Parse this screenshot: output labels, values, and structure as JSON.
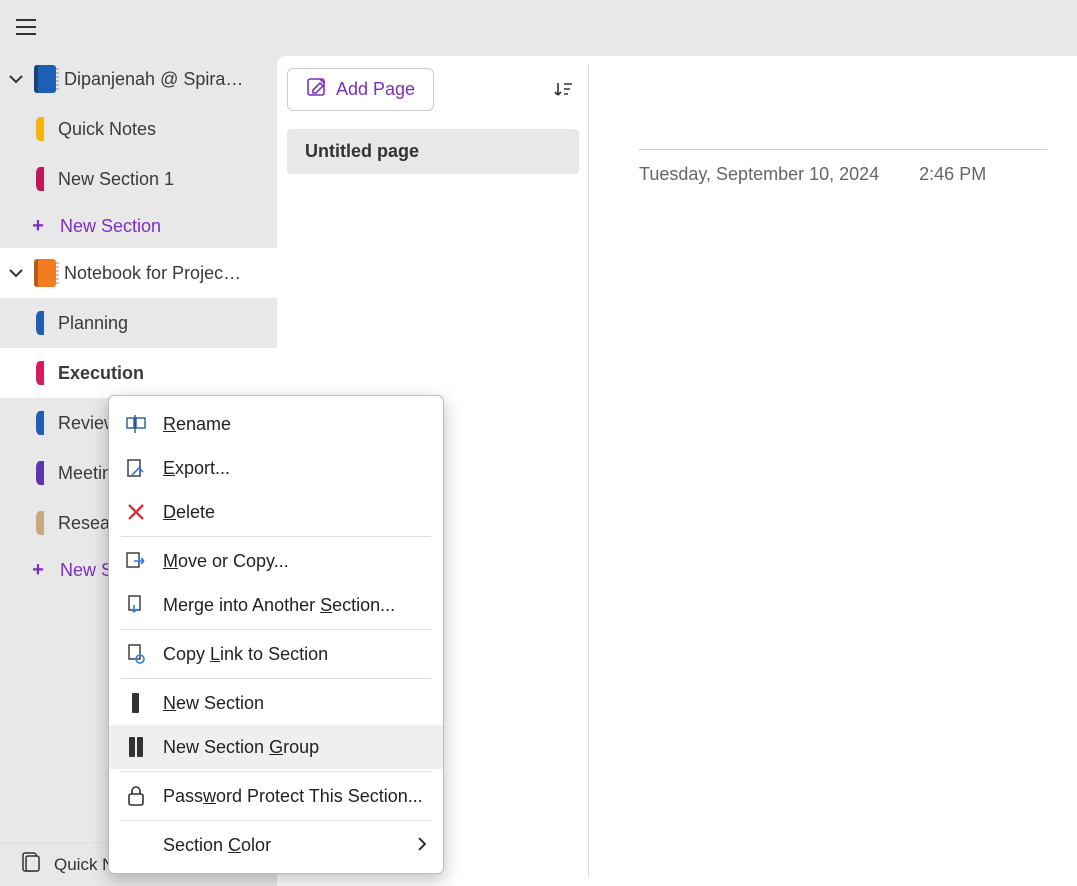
{
  "colors": {
    "accent_purple": "#7b2fbf",
    "tab_yellow": "#f5b400",
    "tab_magenta": "#c2185b",
    "tab_pink": "#d81b60",
    "tab_blue": "#1e5fb4",
    "tab_purple": "#5e35b1",
    "tab_tan": "#c8a97e",
    "delete_red": "#d13438"
  },
  "notebooks": [
    {
      "label": "Dipanjenah @ Spiral…",
      "icon": "blue",
      "expanded": true,
      "sections": [
        {
          "label": "Quick Notes",
          "color_key": "tab_yellow"
        },
        {
          "label": "New Section 1",
          "color_key": "tab_magenta"
        }
      ],
      "add_label": "New Section"
    },
    {
      "label": "Notebook for Project A",
      "icon": "orange",
      "expanded": true,
      "selected": true,
      "sections": [
        {
          "label": "Planning",
          "color_key": "tab_blue"
        },
        {
          "label": "Execution",
          "color_key": "tab_pink",
          "active": true
        },
        {
          "label": "Review",
          "color_key": "tab_blue"
        },
        {
          "label": "Meeting Notes",
          "color_key": "tab_purple"
        },
        {
          "label": "Research",
          "color_key": "tab_tan"
        }
      ],
      "add_label": "New Section"
    }
  ],
  "footer": {
    "quick_notes": "Quick Notes"
  },
  "pagepanel": {
    "add_page": "Add Page",
    "pages": [
      {
        "title": "Untitled page",
        "selected": true
      }
    ]
  },
  "note": {
    "date": "Tuesday, September 10, 2024",
    "time": "2:46 PM"
  },
  "context_menu": {
    "hovered_index": 7,
    "items": [
      {
        "icon": "rename-icon",
        "pre": "",
        "u": "R",
        "post": "ename"
      },
      {
        "icon": "export-icon",
        "pre": "",
        "u": "E",
        "post": "xport..."
      },
      {
        "icon": "delete-icon",
        "pre": "",
        "u": "D",
        "post": "elete",
        "red_icon": true
      },
      {
        "sep": true
      },
      {
        "icon": "move-icon",
        "pre": "",
        "u": "M",
        "post": "ove or Copy..."
      },
      {
        "icon": "merge-icon",
        "pre": "Merge into Another ",
        "u": "S",
        "post": "ection..."
      },
      {
        "sep": true
      },
      {
        "icon": "link-icon",
        "pre": "Copy ",
        "u": "L",
        "post": "ink to Section"
      },
      {
        "sep": true
      },
      {
        "icon": "section-icon",
        "pre": "",
        "u": "N",
        "post": "ew Section"
      },
      {
        "icon": "section-group-icon",
        "pre": "New Section ",
        "u": "G",
        "post": "roup"
      },
      {
        "sep": true
      },
      {
        "icon": "lock-icon",
        "pre": "Pass",
        "u": "w",
        "post": "ord Protect This Section..."
      },
      {
        "sep": true
      },
      {
        "icon": "",
        "pre": "Section ",
        "u": "C",
        "post": "olor",
        "submenu": true
      }
    ]
  }
}
